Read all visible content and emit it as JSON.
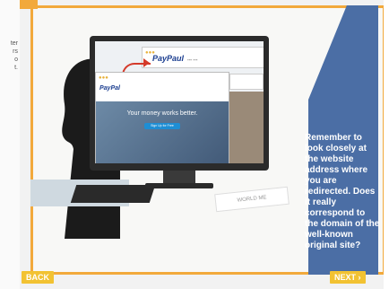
{
  "left_panel": {
    "lines": [
      "ter",
      "rs",
      "o",
      "t."
    ]
  },
  "screen": {
    "brand_top": "PayPaul",
    "brand_top_small": "--- ---",
    "brand_bottom": "PayPal",
    "hero_text": "Your money works better.",
    "hero_button": "Sign Up for Free"
  },
  "paper_text": "WORLD ME",
  "callout": "Remember to look closely at the website address where you are redirected. Does it really correspond to the domain of the well-known original site?",
  "nav": {
    "back_label": "BACK",
    "next_label": "NEXT"
  },
  "colors": {
    "accent": "#f2a93b",
    "panel": "#4b6ea5",
    "button": "#f2c232"
  }
}
